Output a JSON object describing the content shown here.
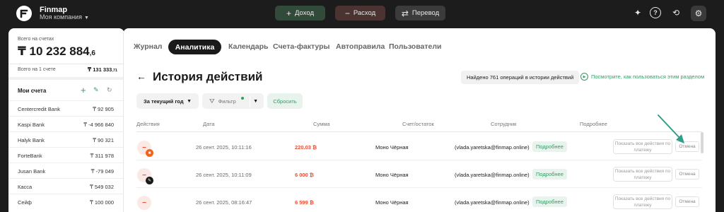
{
  "app": {
    "brand": "Finmap",
    "company": "Моя компания"
  },
  "topbar": {
    "income_label": "Доход",
    "expense_label": "Расход",
    "transfer_label": "Перевод",
    "icons": [
      "sparkle-icon",
      "help-icon",
      "history-icon",
      "settings-icon"
    ]
  },
  "sidebar": {
    "total_label": "Всего на счетах",
    "total_main": "₸ 10 232 884",
    "total_dec": ",6",
    "one_label": "Всего на 1 счете",
    "one_main": "₸ 131 333",
    "one_dec": ",71",
    "accounts_title": "Мои счета",
    "accounts": [
      {
        "name": "Centercredit Bank",
        "value": "₸ 92 905"
      },
      {
        "name": "Kaspi Bank",
        "value": "₸ -4 966 840"
      },
      {
        "name": "Halyk Bank",
        "value": "₸ 90 321"
      },
      {
        "name": "ForteBank",
        "value": "₸ 311 978"
      },
      {
        "name": "Jusan Bank",
        "value": "₸ -79 049"
      },
      {
        "name": "Касса",
        "value": "₸ 549 032"
      },
      {
        "name": "Сейф",
        "value": "₸ 100 000"
      }
    ]
  },
  "tabs": {
    "journal": "Журнал",
    "analytics": "Аналитика",
    "calendar": "Календарь",
    "invoices": "Счета-фактуры",
    "autorules": "Автоправила",
    "users": "Пользователи"
  },
  "page": {
    "title": "История действий",
    "found": "Найдено 761 операций в истории действий",
    "help_link": "Посмотрите, как пользоваться этим разделом"
  },
  "filters": {
    "period": "За текущий год",
    "filter": "Фильтр",
    "reset": "Сбросить"
  },
  "table": {
    "headers": {
      "actions": "Действия",
      "date": "Дата",
      "sum": "Сумма",
      "account": "Счет/остаток",
      "employee": "Сотрудник",
      "details": "Подробнее"
    },
    "rows": [
      {
        "badge": "trash-icon",
        "date": "26 сент. 2025, 10:11:16",
        "sum": "220.03 ₿",
        "account": "Моно Чёрная",
        "user": "(vlada.yaretska@finmap.online)",
        "more": "Подробнее",
        "show_all": "Показать все действия по платежу",
        "cancel": "Отмена"
      },
      {
        "badge": "pencil-icon",
        "date": "26 сент. 2025, 10:11:09",
        "sum": "6 000 ₿",
        "account": "Моно Чёрная",
        "user": "(vlada.yaretska@finmap.online)",
        "more": "Подробнее",
        "show_all": "Показать все действия по платежу",
        "cancel": "Отмена"
      },
      {
        "badge": "",
        "date": "26 сент. 2025, 08:16:47",
        "sum": "6 599 ₿",
        "account": "Моно Чёрная",
        "user": "(vlada.yaretska@finmap.online)",
        "more": "Подробнее",
        "show_all": "Показать все действия по платежу",
        "cancel": "Отмена"
      }
    ]
  },
  "colors": {
    "accent": "#2f9e63",
    "expense": "#e2523a",
    "dark": "#1c1c1c"
  }
}
